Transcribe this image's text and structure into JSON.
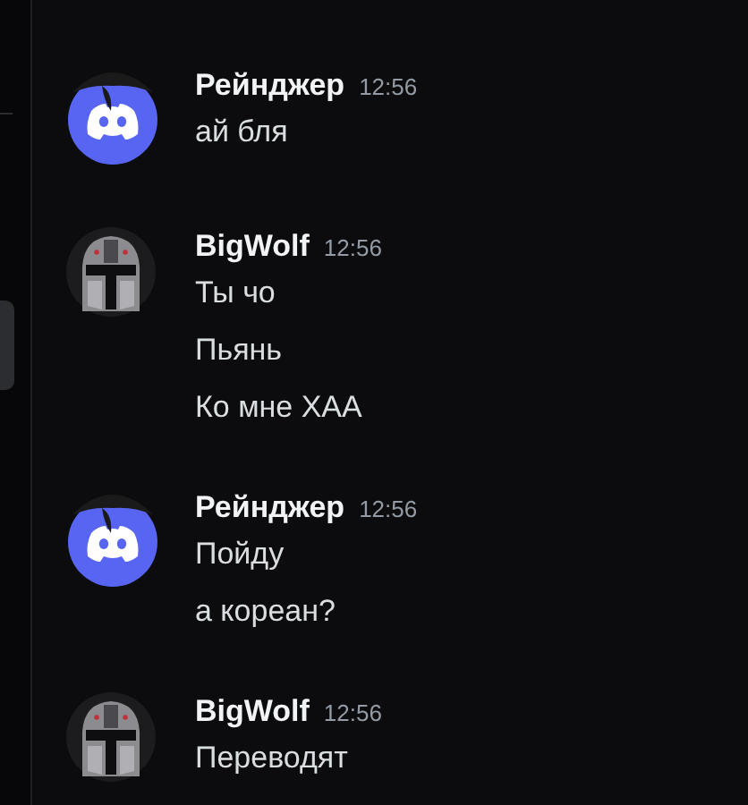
{
  "messages": [
    {
      "author": "Рейнджер",
      "avatar": {
        "kind": "discord"
      },
      "time": "12:56",
      "lines": [
        "ай бля"
      ]
    },
    {
      "author": "BigWolf",
      "avatar": {
        "kind": "helmet"
      },
      "time": "12:56",
      "lines": [
        "Ты чо",
        "Пьянь",
        "Ко мне ХАА"
      ]
    },
    {
      "author": "Рейнджер",
      "avatar": {
        "kind": "discord"
      },
      "time": "12:56",
      "lines": [
        "Пойду",
        "а кореан?"
      ]
    },
    {
      "author": "BigWolf",
      "avatar": {
        "kind": "helmet"
      },
      "time": "12:56",
      "lines": [
        "Переводят"
      ]
    }
  ]
}
